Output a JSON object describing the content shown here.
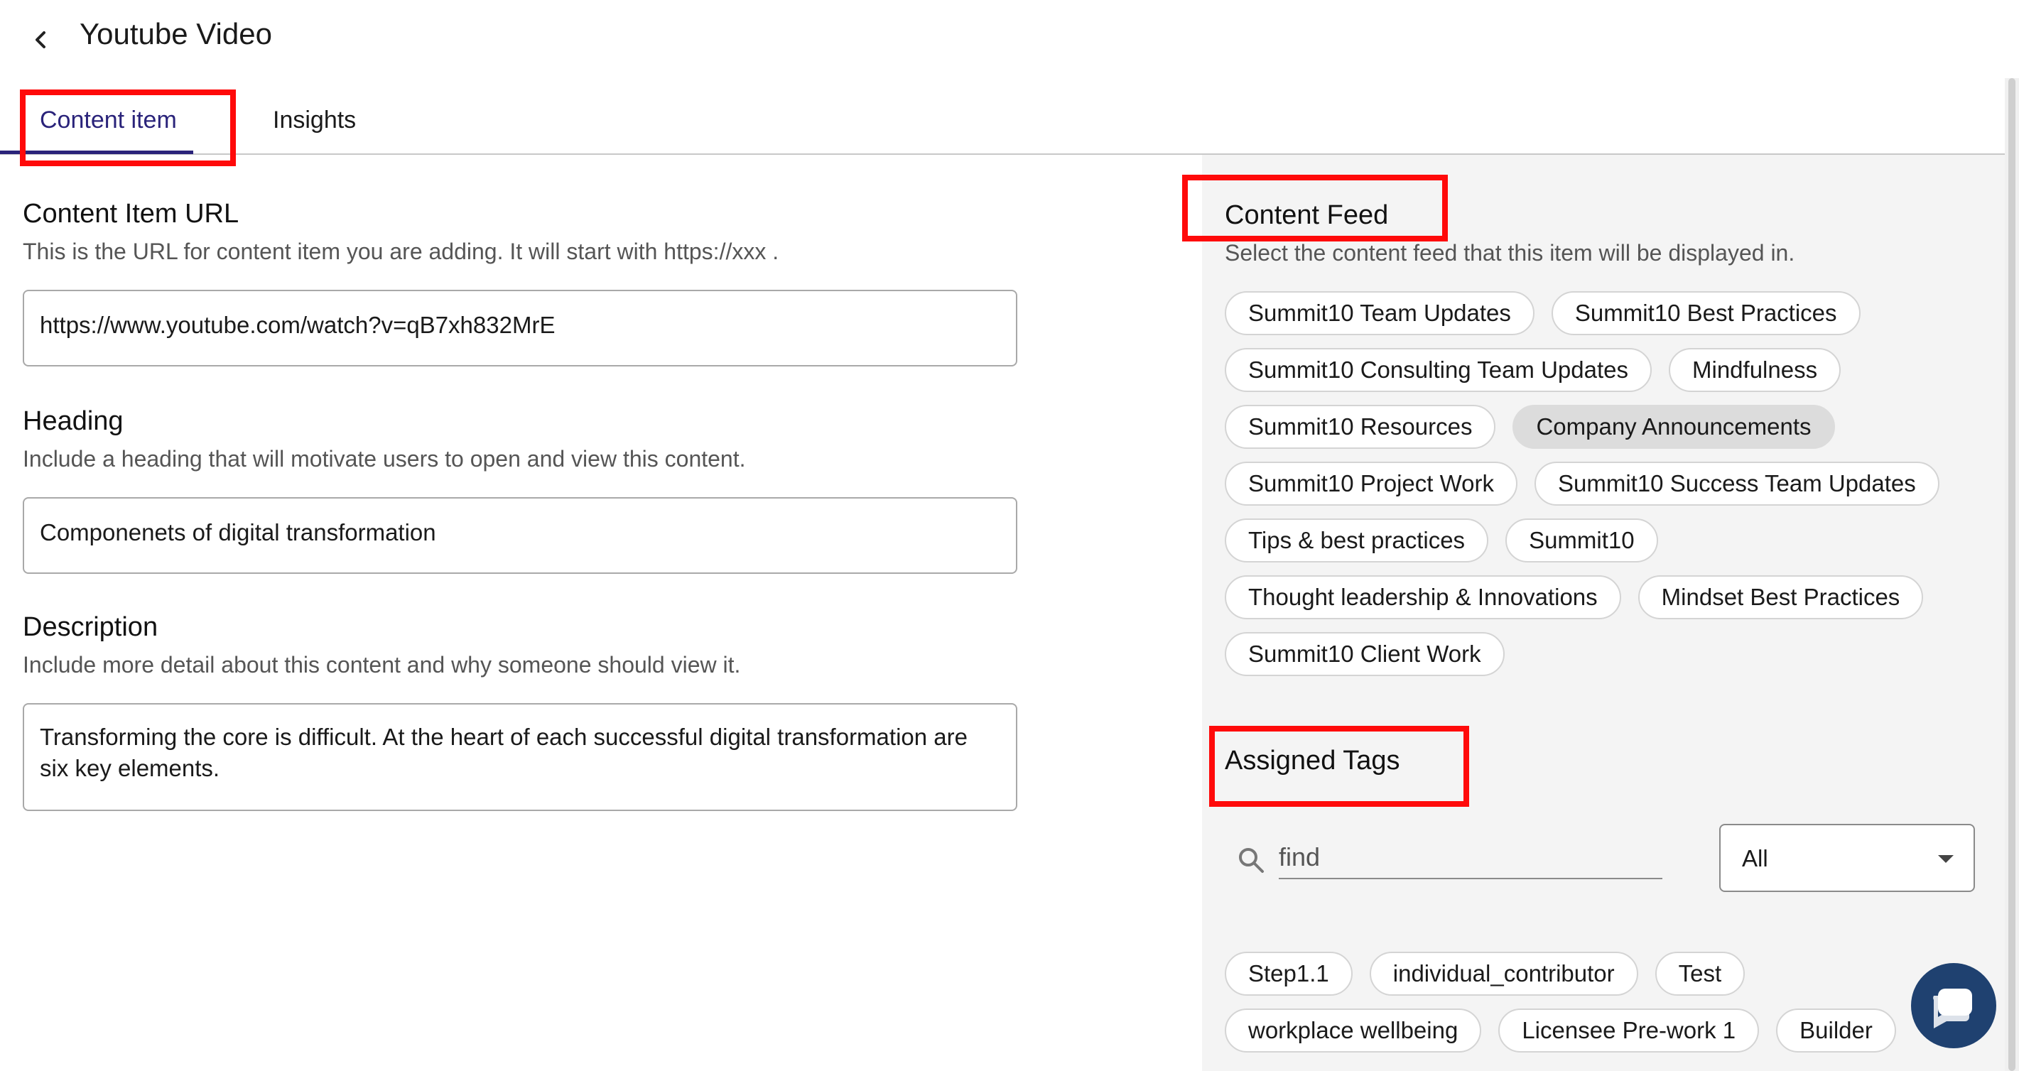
{
  "header": {
    "title": "Youtube Video",
    "back_icon": "chevron-left-icon"
  },
  "tabs": [
    {
      "label": "Content item",
      "active": true
    },
    {
      "label": "Insights",
      "active": false
    }
  ],
  "form": {
    "url": {
      "title": "Content Item URL",
      "help": "This is the URL for content item you are adding. It will start with https://xxx .",
      "value": "https://www.youtube.com/watch?v=qB7xh832MrE"
    },
    "heading": {
      "title": "Heading",
      "help": "Include a heading that will motivate users to open and view this content.",
      "value": "Componenets of digital transformation"
    },
    "description": {
      "title": "Description",
      "help": "Include more detail about this content and why someone should view it.",
      "value": "Transforming the core is difficult. At the heart of each successful digital transformation are six key elements."
    }
  },
  "content_feed": {
    "title": "Content Feed",
    "help": "Select the content feed that this item will be displayed in.",
    "feeds": [
      {
        "label": "Summit10 Team Updates",
        "selected": false
      },
      {
        "label": "Summit10 Best Practices",
        "selected": false
      },
      {
        "label": "Summit10 Consulting Team Updates",
        "selected": false
      },
      {
        "label": "Mindfulness",
        "selected": false
      },
      {
        "label": "Summit10 Resources",
        "selected": false
      },
      {
        "label": "Company Announcements",
        "selected": true
      },
      {
        "label": "Summit10 Project Work",
        "selected": false
      },
      {
        "label": "Summit10 Success Team Updates",
        "selected": false
      },
      {
        "label": "Tips & best practices",
        "selected": false
      },
      {
        "label": "Summit10",
        "selected": false
      },
      {
        "label": "Thought leadership & Innovations",
        "selected": false
      },
      {
        "label": "Mindset Best Practices",
        "selected": false
      },
      {
        "label": "Summit10 Client Work",
        "selected": false
      }
    ]
  },
  "assigned_tags": {
    "title": "Assigned Tags",
    "search_placeholder": "find",
    "filter_value": "All",
    "tags": [
      {
        "label": "Step1.1"
      },
      {
        "label": "individual_contributor"
      },
      {
        "label": "Test"
      },
      {
        "label": "workplace wellbeing"
      },
      {
        "label": "Licensee Pre-work 1"
      },
      {
        "label": "Builder"
      }
    ]
  },
  "colors": {
    "accent": "#2a237a",
    "highlight_box": "#ff0a0a",
    "panel_bg": "#f4f4f4",
    "chat_button": "#1f4170"
  }
}
